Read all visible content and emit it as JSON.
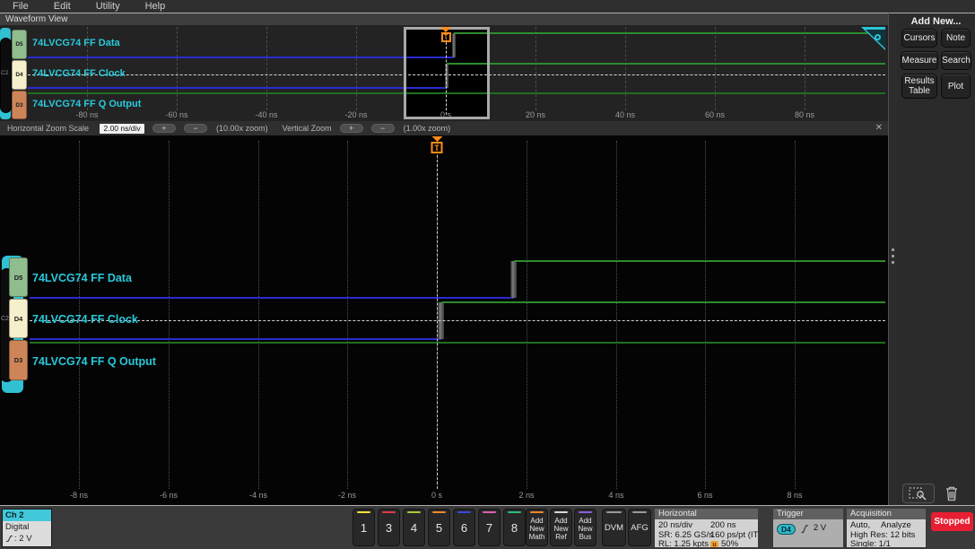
{
  "menu": {
    "items": [
      "File",
      "Edit",
      "Utility",
      "Help"
    ]
  },
  "waveform_view": {
    "title": "Waveform View",
    "group_label": "C2",
    "trigger_label": "T",
    "channels": [
      {
        "id": "D5",
        "label": "74LVCG74 FF Data",
        "chip": "#90bd8e"
      },
      {
        "id": "D4",
        "label": "74LVCG74 FF Clock",
        "chip": "#f5efcb"
      },
      {
        "id": "D3",
        "label": "74LVCG74 FF Q Output",
        "chip": "#cd8558"
      }
    ],
    "overview_axis": [
      "-80 ns",
      "-60 ns",
      "-40 ns",
      "-20 ns",
      "0 s",
      "20 ns",
      "40 ns",
      "60 ns",
      "80 ns"
    ],
    "zoom_axis": [
      "-8 ns",
      "-6 ns",
      "-4 ns",
      "-2 ns",
      "0 s",
      "2 ns",
      "4 ns",
      "6 ns",
      "8 ns"
    ]
  },
  "zoom_toolbar": {
    "h_label": "Horizontal Zoom Scale",
    "h_value": "2.00 ns/div",
    "plus": "+",
    "minus": "−",
    "h_zoom": "(10.00x zoom)",
    "v_label": "Vertical Zoom",
    "v_zoom": "(1.00x zoom)",
    "close": "✕"
  },
  "right_panel": {
    "title": "Add New...",
    "buttons": [
      "Cursors",
      "Note",
      "Measure",
      "Search",
      "Results Table",
      "Plot"
    ]
  },
  "bottom_bar": {
    "ch_badge": {
      "name": "Ch 2",
      "mode": "Digital",
      "threshold": ": 2 V"
    },
    "channel_buttons": [
      {
        "label": "1",
        "color": "#f2e23a"
      },
      {
        "label": "3",
        "color": "#e23a4e"
      },
      {
        "label": "4",
        "color": "#a6cc3a"
      },
      {
        "label": "5",
        "color": "#f08a2d"
      },
      {
        "label": "6",
        "color": "#3a46e0"
      },
      {
        "label": "7",
        "color": "#df5fb4"
      },
      {
        "label": "8",
        "color": "#2bbf77"
      }
    ],
    "add_buttons": [
      {
        "l1": "Add",
        "l2": "New",
        "l3": "Math",
        "color": "#f08a2d"
      },
      {
        "l1": "Add",
        "l2": "New",
        "l3": "Ref",
        "color": "#d8d8d8"
      },
      {
        "l1": "Add",
        "l2": "New",
        "l3": "Bus",
        "color": "#8a5fe0"
      }
    ],
    "dvm": "DVM",
    "afg": "AFG",
    "horizontal": {
      "title": "Horizontal",
      "r1c1": "20 ns/div",
      "r1c2": "200 ns",
      "r2c1": "SR: 6.25 GS/s",
      "r2c2": "160 ps/pt (IT)",
      "r3c1": "RL: 1.25 kpts",
      "r3c2": "50%",
      "pos_icon": "u"
    },
    "trigger": {
      "title": "Trigger",
      "source": "D4",
      "source_color": "#2fb9cb",
      "level": "2 V"
    },
    "acquisition": {
      "title": "Acquisition",
      "r1a": "Auto,",
      "r1b": "Analyze",
      "r2": "High Res: 12 bits",
      "r3": "Single: 1/1"
    },
    "run_state": "Stopped",
    "run_state_color": "#e81f33"
  },
  "chart_data": {
    "type": "digital-timing",
    "zoom_scale": "2.00 ns/div",
    "overview_scale": "20 ns/div",
    "channels": [
      {
        "id": "D5",
        "name": "74LVCG74 FF Data",
        "initial": 0,
        "edges_ns": [
          1.72
        ]
      },
      {
        "id": "D4",
        "name": "74LVCG74 FF Clock",
        "initial": 0,
        "edges_ns": [
          0.1
        ]
      },
      {
        "id": "D3",
        "name": "74LVCG74 FF Q Output",
        "initial": 1,
        "edges_ns": []
      }
    ],
    "zoom_window_ns": [
      -9.1,
      10.1
    ],
    "overview_window_ns": [
      -93,
      99
    ],
    "trigger": {
      "source": "D4",
      "time_ns": 0,
      "level": "2 V"
    },
    "colors": {
      "low": "#2a2ad2",
      "high": "#2e8b2e",
      "q_high": "#1f6f1f",
      "trigger": "#ff8c1a"
    }
  }
}
